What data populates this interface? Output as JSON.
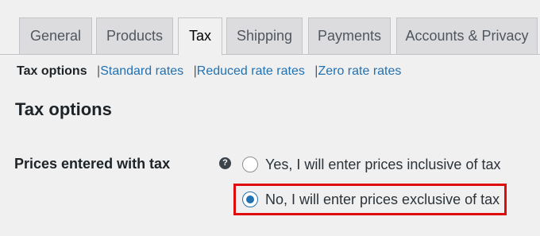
{
  "tabs": [
    {
      "label": "General",
      "active": false
    },
    {
      "label": "Products",
      "active": false
    },
    {
      "label": "Tax",
      "active": true
    },
    {
      "label": "Shipping",
      "active": false
    },
    {
      "label": "Payments",
      "active": false
    },
    {
      "label": "Accounts & Privacy",
      "active": false
    }
  ],
  "subnav": {
    "current": "Tax options",
    "separator": "|",
    "links": [
      "Standard rates",
      "Reduced rate rates",
      "Zero rate rates"
    ]
  },
  "section": {
    "title": "Tax options"
  },
  "prices_field": {
    "label": "Prices entered with tax",
    "help_icon": "question-mark-icon",
    "help_glyph": "?",
    "options": [
      {
        "label": "Yes, I will enter prices inclusive of tax",
        "selected": false
      },
      {
        "label": "No, I will enter prices exclusive of tax",
        "selected": true
      }
    ]
  },
  "colors": {
    "accent": "#2271b1",
    "highlight": "#e00b0b",
    "background": "#f0f0f1"
  }
}
